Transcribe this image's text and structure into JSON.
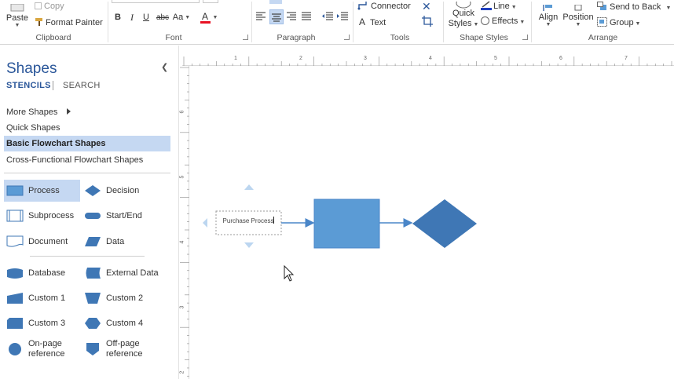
{
  "ribbon": {
    "clipboard": {
      "paste_label": "Paste",
      "copy_label": "Copy",
      "format_painter_label": "Format Painter",
      "group_label": "Clipboard"
    },
    "font": {
      "bold": "B",
      "italic": "I",
      "underline": "U",
      "strikethrough": "abc",
      "font_size_label": "Aa",
      "font_color_label": "A",
      "group_label": "Font"
    },
    "paragraph": {
      "group_label": "Paragraph"
    },
    "tools": {
      "connector_label": "Connector",
      "text_label": "Text",
      "group_label": "Tools"
    },
    "shape_styles": {
      "quick_styles_label_1": "Quick",
      "quick_styles_label_2": "Styles",
      "line_label": "Line",
      "effects_label": "Effects",
      "group_label": "Shape Styles"
    },
    "arrange": {
      "align_label": "Align",
      "position_label": "Position",
      "send_to_back_label": "Send to Back",
      "group_label_btn": "Group",
      "group_label": "Arrange"
    },
    "colors": {
      "font_color_bar": "#e81123",
      "line_color_bar": "#1f3fbf"
    }
  },
  "pane": {
    "title": "Shapes",
    "tabs": [
      "STENCILS",
      "SEARCH"
    ],
    "stencils": [
      "More Shapes",
      "Quick Shapes",
      "Basic Flowchart Shapes",
      "Cross-Functional Flowchart Shapes"
    ],
    "shapes": [
      "Process",
      "Decision",
      "Subprocess",
      "Start/End",
      "Document",
      "Data",
      "Database",
      "External Data",
      "Custom 1",
      "Custom 2",
      "Custom 3",
      "Custom 4",
      "On-page reference",
      "Off-page reference"
    ]
  },
  "rulers": {
    "top_labels": [
      "1",
      "2",
      "3",
      "4",
      "5",
      "6",
      "7"
    ],
    "left_labels": [
      "6",
      "5",
      "4",
      "3",
      "2"
    ]
  },
  "canvas": {
    "text_shape_label": "Purchase Process"
  },
  "colors": {
    "accent": "#2b579a",
    "shape_fill": "#5b9bd5",
    "shape_dark": "#3f77b5",
    "selected_bg": "#c5d8f2"
  }
}
